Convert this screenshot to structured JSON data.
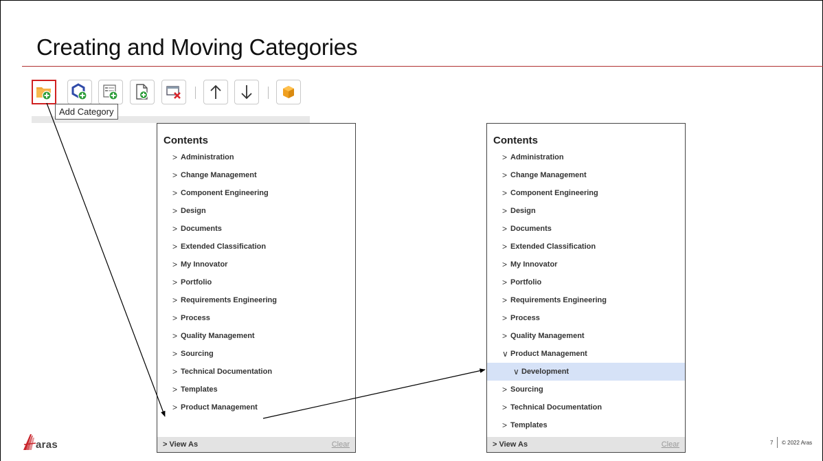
{
  "slide": {
    "title": "Creating and Moving Categories",
    "page_number": "7",
    "copyright": "© 2022 Aras",
    "logo_text": "aras",
    "accent_color": "#b03030"
  },
  "toolbar": {
    "buttons": [
      {
        "icon": "folder-add-icon",
        "tooltip": "Add Category",
        "active": true
      },
      {
        "icon": "hexagon-add-icon",
        "active": false
      },
      {
        "icon": "form-add-icon",
        "active": false
      },
      {
        "icon": "document-add-icon",
        "active": false
      },
      {
        "icon": "remove-window-icon",
        "active": false
      },
      {
        "icon": "arrow-up-icon",
        "active": false
      },
      {
        "icon": "arrow-down-icon",
        "active": false
      },
      {
        "icon": "package-icon",
        "active": false
      }
    ],
    "tooltip_text": "Add Category"
  },
  "left_panel": {
    "title": "Contents",
    "items": [
      {
        "label": "Administration",
        "expanded": false,
        "level": 0
      },
      {
        "label": "Change Management",
        "expanded": false,
        "level": 0
      },
      {
        "label": "Component Engineering",
        "expanded": false,
        "level": 0
      },
      {
        "label": "Design",
        "expanded": false,
        "level": 0
      },
      {
        "label": "Documents",
        "expanded": false,
        "level": 0
      },
      {
        "label": "Extended Classification",
        "expanded": false,
        "level": 0
      },
      {
        "label": "My Innovator",
        "expanded": false,
        "level": 0
      },
      {
        "label": "Portfolio",
        "expanded": false,
        "level": 0
      },
      {
        "label": "Requirements Engineering",
        "expanded": false,
        "level": 0
      },
      {
        "label": "Process",
        "expanded": false,
        "level": 0
      },
      {
        "label": "Quality Management",
        "expanded": false,
        "level": 0
      },
      {
        "label": "Sourcing",
        "expanded": false,
        "level": 0
      },
      {
        "label": "Technical Documentation",
        "expanded": false,
        "level": 0
      },
      {
        "label": "Templates",
        "expanded": false,
        "level": 0
      },
      {
        "label": "Product Management",
        "expanded": false,
        "level": 0
      }
    ],
    "footer_label": "View As",
    "clear_label": "Clear"
  },
  "right_panel": {
    "title": "Contents",
    "items": [
      {
        "label": "Administration",
        "expanded": false,
        "level": 0
      },
      {
        "label": "Change Management",
        "expanded": false,
        "level": 0
      },
      {
        "label": "Component Engineering",
        "expanded": false,
        "level": 0
      },
      {
        "label": "Design",
        "expanded": false,
        "level": 0
      },
      {
        "label": "Documents",
        "expanded": false,
        "level": 0
      },
      {
        "label": "Extended Classification",
        "expanded": false,
        "level": 0
      },
      {
        "label": "My Innovator",
        "expanded": false,
        "level": 0
      },
      {
        "label": "Portfolio",
        "expanded": false,
        "level": 0
      },
      {
        "label": "Requirements Engineering",
        "expanded": false,
        "level": 0
      },
      {
        "label": "Process",
        "expanded": false,
        "level": 0
      },
      {
        "label": "Quality Management",
        "expanded": false,
        "level": 0
      },
      {
        "label": "Product Management",
        "expanded": true,
        "level": 0
      },
      {
        "label": "Development",
        "expanded": true,
        "level": 1,
        "selected": true
      },
      {
        "label": "Sourcing",
        "expanded": false,
        "level": 0
      },
      {
        "label": "Technical Documentation",
        "expanded": false,
        "level": 0
      },
      {
        "label": "Templates",
        "expanded": false,
        "level": 0
      }
    ],
    "footer_label": "View As",
    "clear_label": "Clear"
  }
}
